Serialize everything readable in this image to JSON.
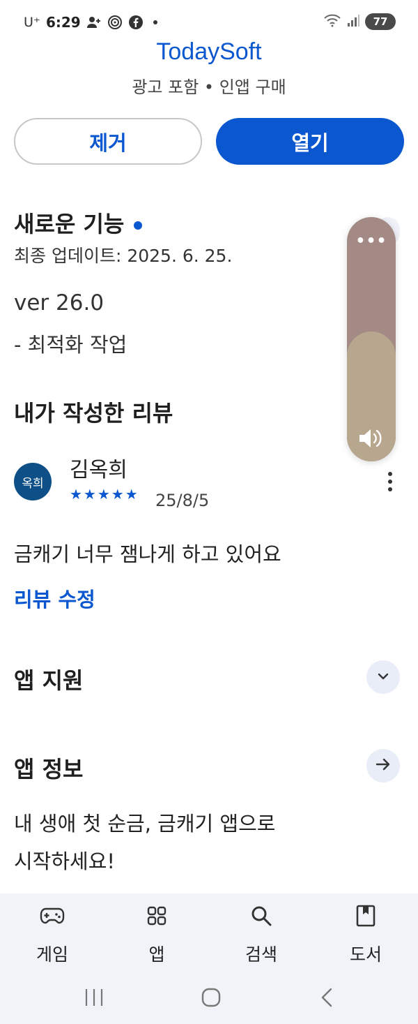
{
  "status_bar": {
    "carrier": "U⁺",
    "time": "6:29",
    "battery": "77",
    "left_icons": [
      "person-add-icon",
      "nfc-icon",
      "facebook-icon"
    ],
    "right_icons": [
      "wifi-icon",
      "signal-icon",
      "battery-icon"
    ]
  },
  "app": {
    "title": "TodaySoft",
    "meta": "광고 포함 • 인앱 구매"
  },
  "actions": {
    "remove_label": "제거",
    "open_label": "열기"
  },
  "whats_new": {
    "title": "새로운 기능",
    "updated": "최종 업데이트: 2025. 6. 25.",
    "version": "ver 26.0",
    "note": "- 최적화 작업"
  },
  "my_review": {
    "title": "내가 작성한 리뷰",
    "avatar_text": "옥희",
    "reviewer_name": "김옥희",
    "stars": "★★★★★",
    "rating": 5,
    "date": "25/8/5",
    "body": "금캐기 너무 잼나게 하고 있어요",
    "edit_label": "리뷰 수정"
  },
  "app_support": {
    "title": "앱 지원"
  },
  "app_info": {
    "title": "앱 정보",
    "line1": "내 생애 첫 순금, 금캐기 앱으로",
    "line2": "시작하세요!"
  },
  "volume_overlay": {
    "level": 0.53,
    "menu_glyph": "•••"
  },
  "bottom_nav": {
    "items": [
      {
        "label": "게임",
        "icon": "gamepad-icon"
      },
      {
        "label": "앱",
        "icon": "apps-grid-icon"
      },
      {
        "label": "검색",
        "icon": "search-icon"
      },
      {
        "label": "도서",
        "icon": "book-icon"
      }
    ]
  },
  "colors": {
    "accent": "#0b57d0",
    "avatar": "#0d4f86",
    "volume_track": "#a38a85",
    "volume_fill": "#b8a78f",
    "nav_bg": "#f0f4f9"
  }
}
